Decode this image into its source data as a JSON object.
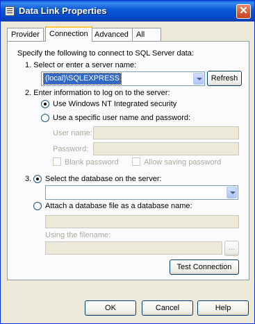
{
  "window": {
    "title": "Data Link Properties",
    "close_label": "✕"
  },
  "tabs": [
    "Provider",
    "Connection",
    "Advanced",
    "All"
  ],
  "intro": "Specify the following to connect to SQL Server data:",
  "step1": {
    "label": "1. Select or enter a server name:",
    "server_value": "(local)\\SQLEXPRESS",
    "refresh_label": "Refresh"
  },
  "step2": {
    "label": "2. Enter information to log on to the server:",
    "option_nt": "Use Windows NT Integrated security",
    "option_specific": "Use a specific user name and password:",
    "user_name_label": "User name:",
    "password_label": "Password:",
    "blank_password": "Blank password",
    "allow_saving": "Allow saving password"
  },
  "step3": {
    "number": "3.",
    "option_select_db": "Select the database on the server:",
    "option_attach": "Attach a database file as a database name:",
    "filename_label": "Using the filename:",
    "browse_label": "..."
  },
  "test_connection_label": "Test Connection",
  "footer": {
    "ok_label": "OK",
    "cancel_label": "Cancel",
    "help_label": "Help"
  },
  "colors": {
    "titlebar": "#0549c8",
    "face": "#ece9d8",
    "selection": "#316ac5",
    "tab_accent": "#ffc83c"
  }
}
